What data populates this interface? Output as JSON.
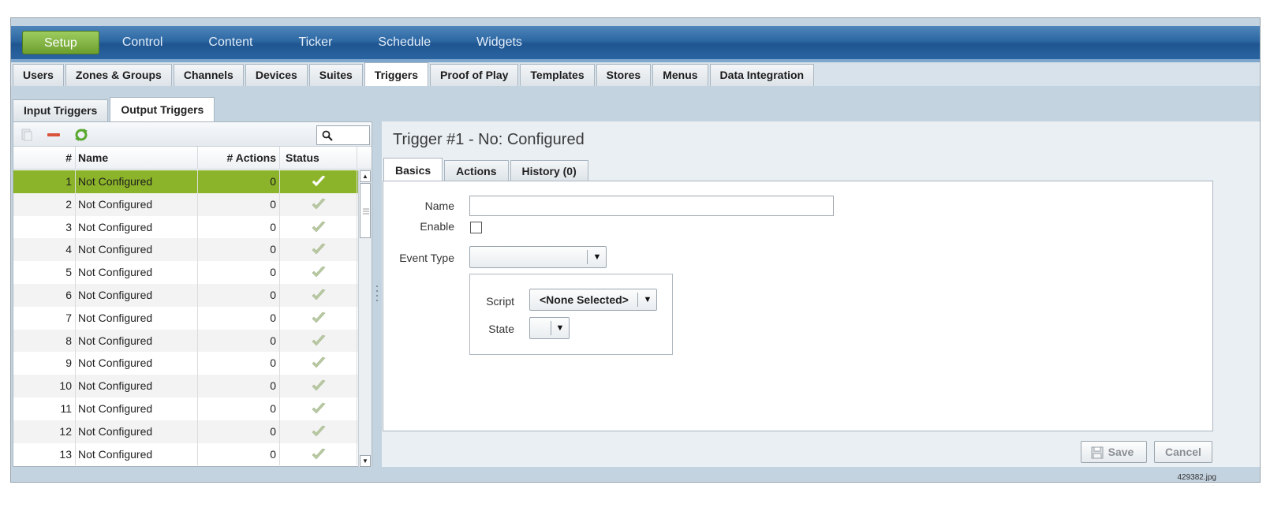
{
  "topnav": {
    "items": [
      {
        "label": "Setup",
        "active": true
      },
      {
        "label": "Control",
        "active": false
      },
      {
        "label": "Content",
        "active": false
      },
      {
        "label": "Ticker",
        "active": false
      },
      {
        "label": "Schedule",
        "active": false
      },
      {
        "label": "Widgets",
        "active": false
      }
    ]
  },
  "maintabs": {
    "items": [
      {
        "label": "Users"
      },
      {
        "label": "Zones & Groups"
      },
      {
        "label": "Channels"
      },
      {
        "label": "Devices"
      },
      {
        "label": "Suites"
      },
      {
        "label": "Triggers"
      },
      {
        "label": "Proof of Play"
      },
      {
        "label": "Templates"
      },
      {
        "label": "Stores"
      },
      {
        "label": "Menus"
      },
      {
        "label": "Data Integration"
      }
    ],
    "active": "Triggers"
  },
  "subtabs": {
    "items": [
      {
        "label": "Input Triggers"
      },
      {
        "label": "Output Triggers"
      }
    ],
    "active": "Output Triggers"
  },
  "list": {
    "columns": {
      "num": "#",
      "name": "Name",
      "actions": "# Actions",
      "status": "Status"
    },
    "selected_row": 1,
    "rows": [
      {
        "num": "1",
        "name": "Not Configured",
        "actions": "0"
      },
      {
        "num": "2",
        "name": "Not Configured",
        "actions": "0"
      },
      {
        "num": "3",
        "name": "Not Configured",
        "actions": "0"
      },
      {
        "num": "4",
        "name": "Not Configured",
        "actions": "0"
      },
      {
        "num": "5",
        "name": "Not Configured",
        "actions": "0"
      },
      {
        "num": "6",
        "name": "Not Configured",
        "actions": "0"
      },
      {
        "num": "7",
        "name": "Not Configured",
        "actions": "0"
      },
      {
        "num": "8",
        "name": "Not Configured",
        "actions": "0"
      },
      {
        "num": "9",
        "name": "Not Configured",
        "actions": "0"
      },
      {
        "num": "10",
        "name": "Not Configured",
        "actions": "0"
      },
      {
        "num": "11",
        "name": "Not Configured",
        "actions": "0"
      },
      {
        "num": "12",
        "name": "Not Configured",
        "actions": "0"
      },
      {
        "num": "13",
        "name": "Not Configured",
        "actions": "0"
      }
    ]
  },
  "detail": {
    "title": "Trigger #1 - No: Configured",
    "tabs": [
      {
        "label": "Basics"
      },
      {
        "label": "Actions"
      },
      {
        "label": "History (0)"
      }
    ],
    "active_tab": "Basics",
    "form": {
      "name_label": "Name",
      "name_value": "",
      "enable_label": "Enable",
      "event_type_label": "Event Type",
      "event_type_value": "",
      "script_label": "Script",
      "script_value": "<None Selected>",
      "state_label": "State",
      "state_value": ""
    },
    "buttons": {
      "save": "Save",
      "cancel": "Cancel"
    }
  },
  "footer_filename": "429382.jpg",
  "colors": {
    "selected_row": "#8cb42a",
    "nav_active": "#7fb044",
    "nav_bar": "#2c67a3"
  }
}
